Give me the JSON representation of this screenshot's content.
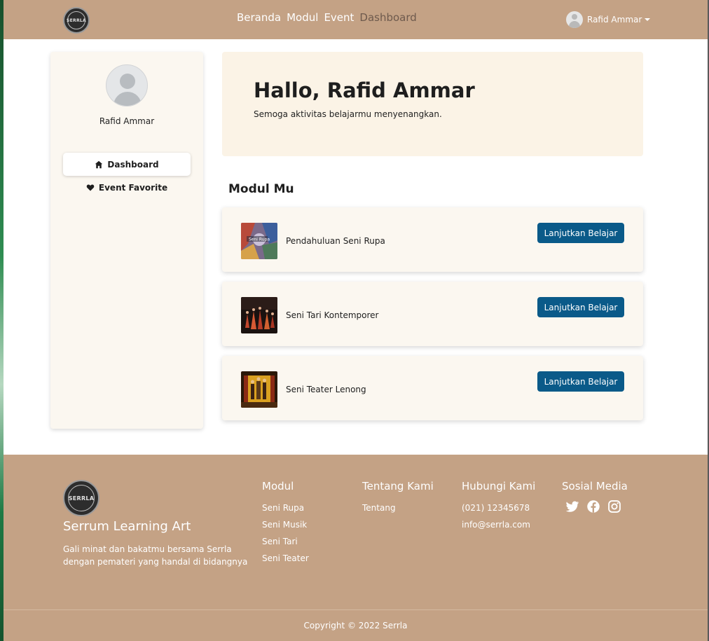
{
  "nav": {
    "logo_text": "SERRLA",
    "links": [
      "Beranda",
      "Modul",
      "Event",
      "Dashboard"
    ],
    "active_link": "Dashboard",
    "user_name": "Rafid Ammar"
  },
  "sidebar": {
    "user_name": "Rafid Ammar",
    "items": [
      {
        "label": "Dashboard",
        "icon": "home-icon",
        "active": true
      },
      {
        "label": "Event Favorite",
        "icon": "heart-icon",
        "active": false
      }
    ]
  },
  "hero": {
    "title": "Hallo, Rafid Ammar",
    "subtitle": "Semoga aktivitas belajarmu menyenangkan."
  },
  "modules": {
    "section_title": "Modul Mu",
    "button_label": "Lanjutkan Belajar",
    "items": [
      {
        "name": "Pendahuluan Seni Rupa",
        "thumb_text": "Seni Rupa"
      },
      {
        "name": "Seni Tari Kontemporer"
      },
      {
        "name": "Seni Teater Lenong"
      }
    ]
  },
  "footer": {
    "logo_text": "SERRLA",
    "brand_name": "Serrum Learning Art",
    "brand_desc": "Gali minat dan bakatmu bersama Serrla dengan pemateri yang handal di bidangnya",
    "columns": [
      {
        "heading": "Modul",
        "links": [
          "Seni Rupa",
          "Seni Musik",
          "Seni Tari",
          "Seni Teater"
        ]
      },
      {
        "heading": "Tentang Kami",
        "links": [
          "Tentang"
        ]
      },
      {
        "heading": "Hubungi Kami",
        "links": [
          "(021) 12345678",
          "info@serrla.com"
        ]
      }
    ],
    "social_heading": "Sosial Media",
    "social_icons": [
      "twitter-icon",
      "facebook-icon",
      "instagram-icon"
    ],
    "copyright": "Copyright © 2022 Serrla"
  },
  "colors": {
    "nav_bg": "#c4a285",
    "accent_button": "#0a5a89",
    "hero_bg": "#fbf3e6",
    "card_bg": "#fbf7f0"
  }
}
